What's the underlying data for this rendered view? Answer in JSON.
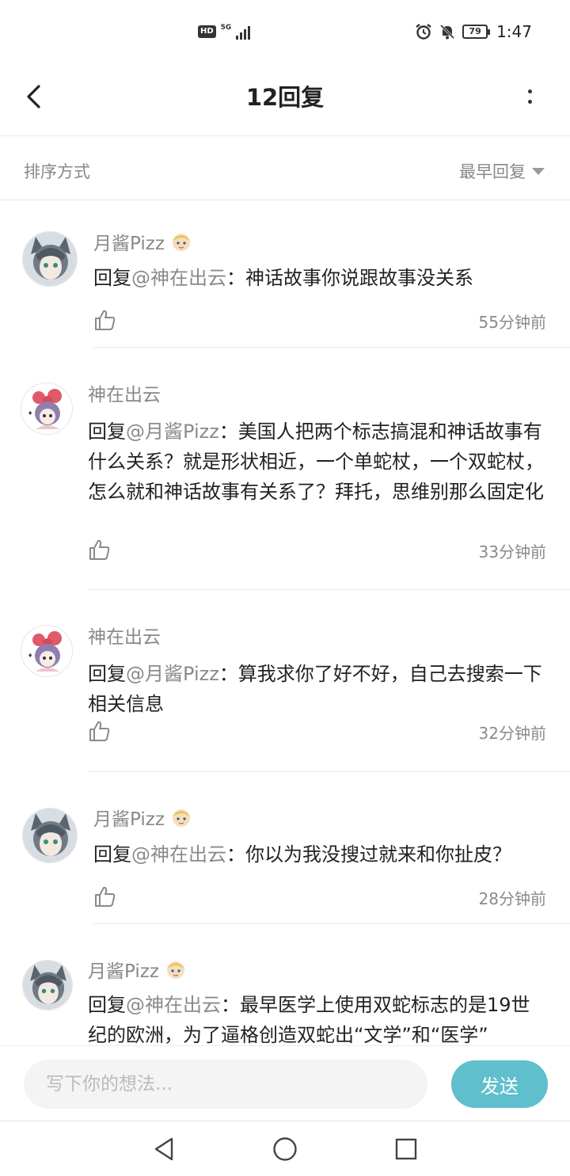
{
  "status_bar": {
    "hd": "HD",
    "network": "5G",
    "battery": "79",
    "time": "1:47"
  },
  "header": {
    "title": "12回复"
  },
  "sort": {
    "label": "排序方式",
    "selected": "最早回复"
  },
  "replies": [
    {
      "author": "月酱Pizz",
      "reply_prefix": "回复",
      "mention": "@神在出云",
      "text": "：神话故事你说跟故事没关系",
      "time": "55分钟前"
    },
    {
      "author": "神在出云",
      "reply_prefix": "回复",
      "mention": "@月酱Pizz",
      "text": "：美国人把两个标志搞混和神话故事有什么关系？就是形状相近，一个单蛇杖，一个双蛇杖，怎么就和神话故事有关系了？拜托，思维别那么固定化",
      "time": "33分钟前"
    },
    {
      "author": "神在出云",
      "reply_prefix": "回复",
      "mention": "@月酱Pizz",
      "text": "：算我求你了好不好，自己去搜索一下相关信息",
      "time": "32分钟前"
    },
    {
      "author": "月酱Pizz",
      "reply_prefix": "回复",
      "mention": "@神在出云",
      "text": "：你以为我没搜过就来和你扯皮？",
      "time": "28分钟前"
    },
    {
      "author": "月酱Pizz",
      "reply_prefix": "回复",
      "mention": "@神在出云",
      "text": "：最早医学上使用双蛇标志的是19世纪的欧洲，为了逼格创造双蛇出“文学”和“医学”",
      "time": ""
    }
  ],
  "input": {
    "placeholder": "写下你的想法..."
  },
  "send_button": "发送",
  "colors": {
    "accent": "#5fbfcc",
    "muted_text": "#888888",
    "main_text": "#222222"
  },
  "icons": {
    "back": "chevron-left-icon",
    "more": "more-vertical-icon",
    "like": "thumbs-up-icon",
    "sort": "triangle-down-icon",
    "nav_back": "triangle-back-icon",
    "nav_home": "circle-home-icon",
    "nav_recent": "square-recent-icon"
  }
}
